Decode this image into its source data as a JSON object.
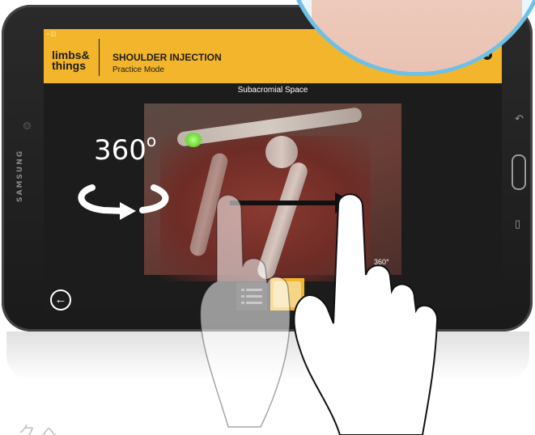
{
  "device": {
    "brand": "SAMSUNG"
  },
  "app": {
    "status_icons": "▫ ◫",
    "logo_line1": "limbs&",
    "logo_line2": "things",
    "title": "SHOULDER INJECTION",
    "subtitle": "Practice Mode",
    "view_label": "Subacromial Space",
    "rotate_label": "360",
    "rotate_degree": "o",
    "mini_rotate_label": "360°"
  },
  "icons": {
    "back": "back-arrow-icon",
    "settings": "gear-icon",
    "glasses": "vr-glasses-icon",
    "list": "list-icon",
    "rotate": "rotate-arrows-icon",
    "hand": "pointing-hand-icon"
  },
  "colors": {
    "accent": "#f3b52b",
    "screen_bg": "#1c1c1c",
    "bubble_border": "#6dc0e6",
    "injection_marker": "#6fdc3b"
  },
  "footer": {
    "glyphs": "ク へ"
  }
}
